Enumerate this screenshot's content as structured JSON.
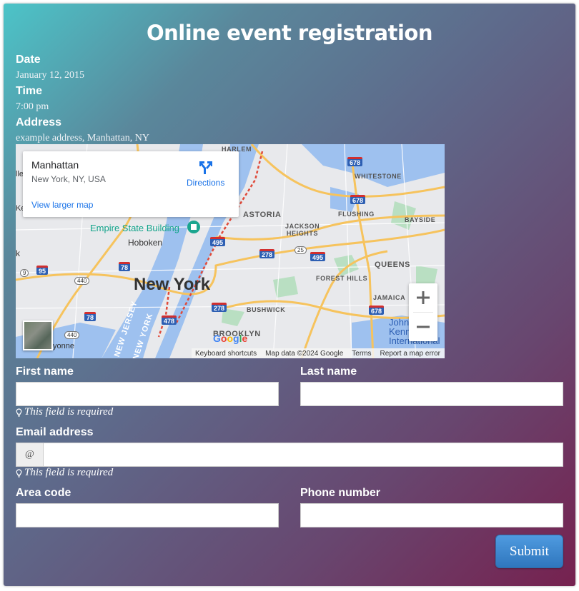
{
  "form": {
    "title": "Online event registration",
    "date_label": "Date",
    "date_value": "January 12, 2015",
    "time_label": "Time",
    "time_value": "7:00 pm",
    "address_label": "Address",
    "address_value": "example address, Manhattan, NY",
    "first_name_label": "First name",
    "first_name_value": "",
    "last_name_label": "Last name",
    "last_name_value": "",
    "first_name_error": "This field is required",
    "email_label": "Email address",
    "email_addon": "@",
    "email_value": "",
    "email_error": "This field is required",
    "area_code_label": "Area code",
    "area_code_value": "",
    "phone_label": "Phone number",
    "phone_value": "",
    "submit_label": "Submit"
  },
  "map": {
    "place_name": "Manhattan",
    "place_address": "New York, NY, USA",
    "directions_label": "Directions",
    "larger_map_label": "View larger map",
    "labels": {
      "city": "New York",
      "poi": "Empire State Building",
      "hoboken": "Hoboken",
      "astoria": "ASTORIA",
      "jackson_heights": "JACKSON HEIGHTS",
      "flushing": "FLUSHING",
      "whitestone": "WHITESTONE",
      "bayside": "BAYSIDE",
      "queens": "QUEENS",
      "forest_hills": "FOREST HILLS",
      "jamaica": "JAMAICA",
      "bushwick": "BUSHWICK",
      "brooklyn": "BROOKLYN",
      "harlem": "HARLEM",
      "new_jersey": "NEW JERSEY",
      "new_york_state": "NEW YORK",
      "bayonne": "yonne",
      "jfk": "John F. Kennedy International",
      "edge_k": "k",
      "edge_ke": "Ke",
      "edge_lle": "lle"
    },
    "shields": {
      "i678_a": "678",
      "i678_b": "678",
      "i678_c": "678",
      "i678_d": "678",
      "i495_a": "495",
      "i495_b": "495",
      "i495_c": "495",
      "i278_a": "278",
      "i278_b": "278",
      "i478": "478",
      "i78_a": "78",
      "i78_b": "78",
      "i95": "95",
      "i9": "9",
      "i440_a": "440",
      "i440_b": "440",
      "i25": "25"
    },
    "google_logo": "Google",
    "attribution": {
      "shortcuts": "Keyboard shortcuts",
      "data": "Map data ©2024 Google",
      "terms": "Terms",
      "report": "Report a map error"
    },
    "colors": {
      "land": "#e8e9ec",
      "water": "#9ec1ef",
      "park": "#b9dfc2",
      "highway": "#f6c35d",
      "link": "#1a73e8"
    }
  }
}
